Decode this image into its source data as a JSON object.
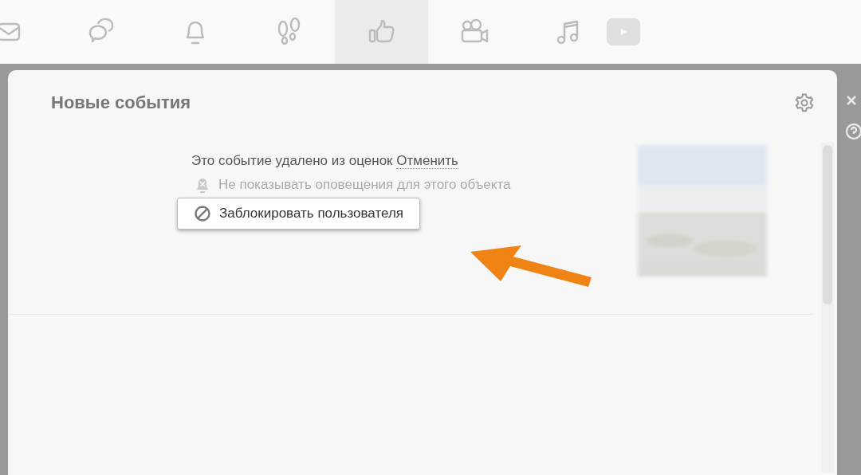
{
  "nav_tabs": [
    {
      "kind": "mail",
      "selected": false
    },
    {
      "kind": "chat",
      "selected": false
    },
    {
      "kind": "bell",
      "selected": false
    },
    {
      "kind": "footprints",
      "selected": false
    },
    {
      "kind": "like",
      "selected": true
    },
    {
      "kind": "camera",
      "selected": false
    },
    {
      "kind": "music",
      "selected": false
    },
    {
      "kind": "video",
      "selected": false
    }
  ],
  "dialog": {
    "title": "Новые события",
    "event": {
      "message": "Это событие удалено из оценок",
      "undo_link": "Отменить",
      "mute_option": "Не показывать оповещения для этого объекта",
      "block_button": "Заблокировать пользователя"
    }
  }
}
